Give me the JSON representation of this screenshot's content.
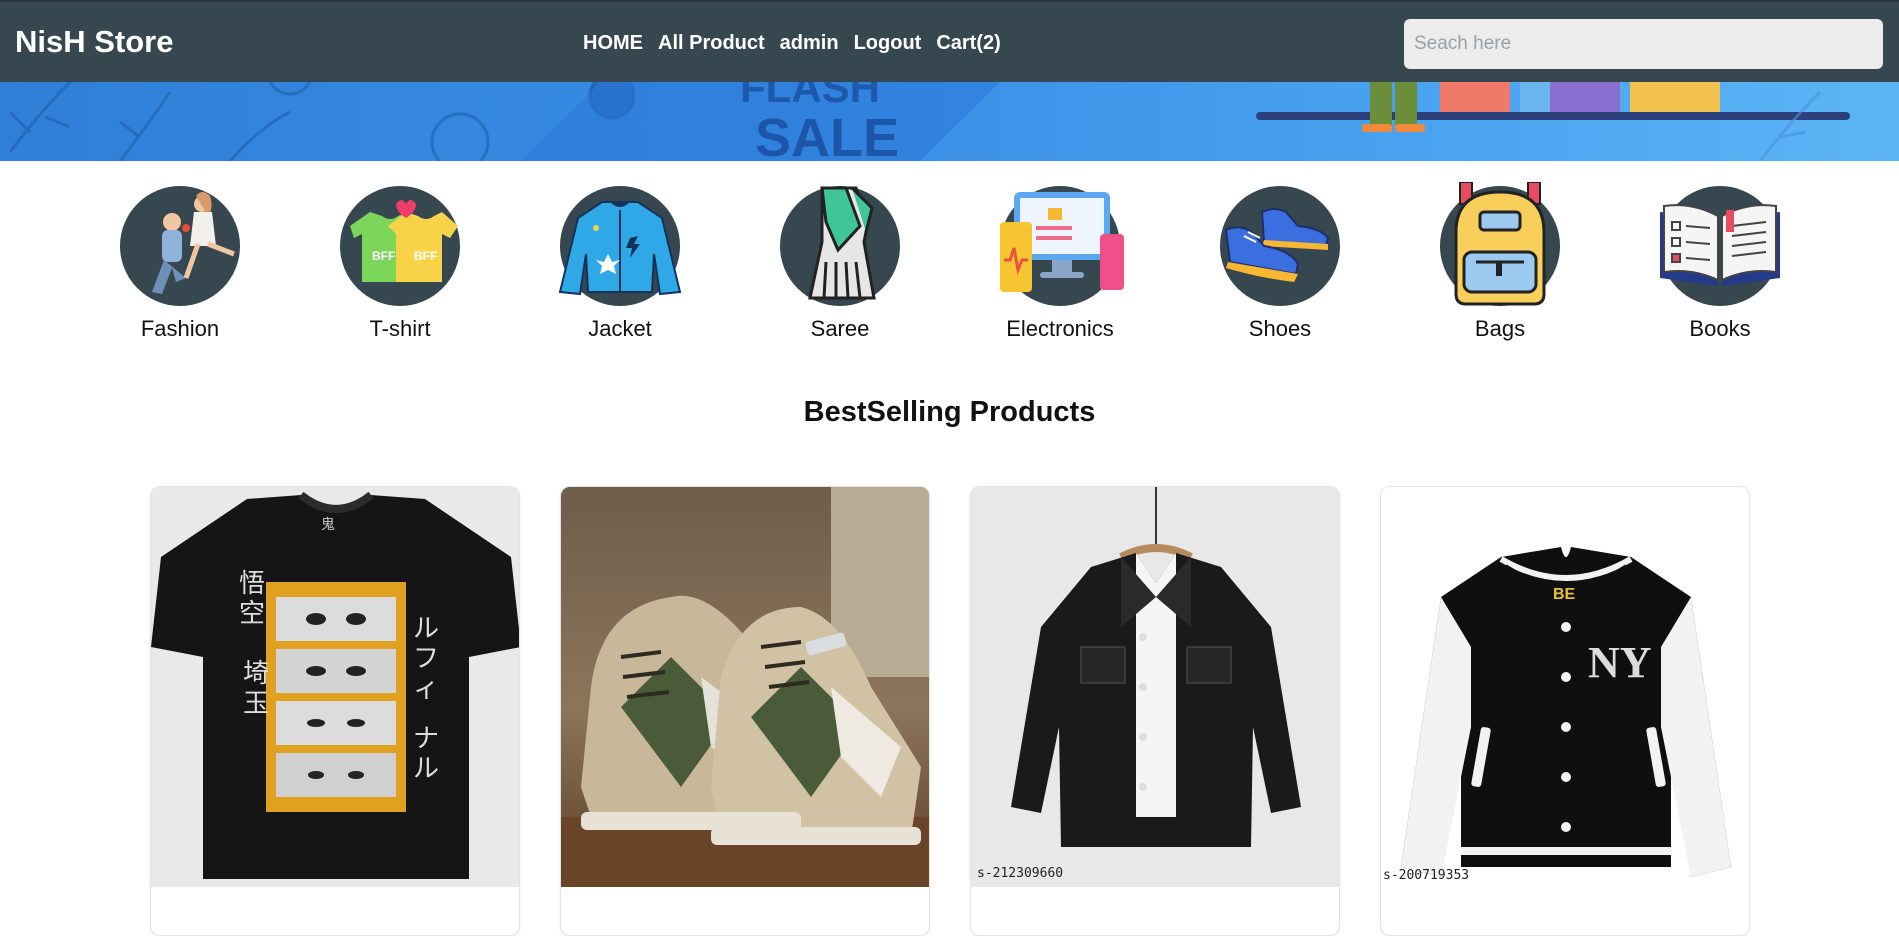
{
  "navbar": {
    "brand": "NisH Store",
    "links": [
      "HOME",
      "All Product",
      "admin",
      "Logout",
      "Cart(2)"
    ],
    "search_placeholder": "Seach here"
  },
  "categories": [
    {
      "label": "Fashion",
      "icon": "couple-fashion-icon"
    },
    {
      "label": "T-shirt",
      "icon": "tshirt-icon"
    },
    {
      "label": "Jacket",
      "icon": "jacket-icon"
    },
    {
      "label": "Saree",
      "icon": "saree-icon"
    },
    {
      "label": "Electronics",
      "icon": "electronics-icon"
    },
    {
      "label": "Shoes",
      "icon": "shoes-icon"
    },
    {
      "label": "Bags",
      "icon": "backpack-icon"
    },
    {
      "label": "Books",
      "icon": "book-icon"
    }
  ],
  "section": {
    "title": "BestSelling Products"
  },
  "products": [
    {
      "image": "anime-tshirt-image",
      "watermark": ""
    },
    {
      "image": "sneakers-image",
      "watermark": ""
    },
    {
      "image": "denim-jacket-image",
      "watermark": "s-212309660"
    },
    {
      "image": "varsity-jacket-image",
      "watermark": "s-200719353"
    }
  ],
  "colors": {
    "navbar": "#37474f",
    "category_circle": "#37474f",
    "banner": "#3a8ee6"
  }
}
